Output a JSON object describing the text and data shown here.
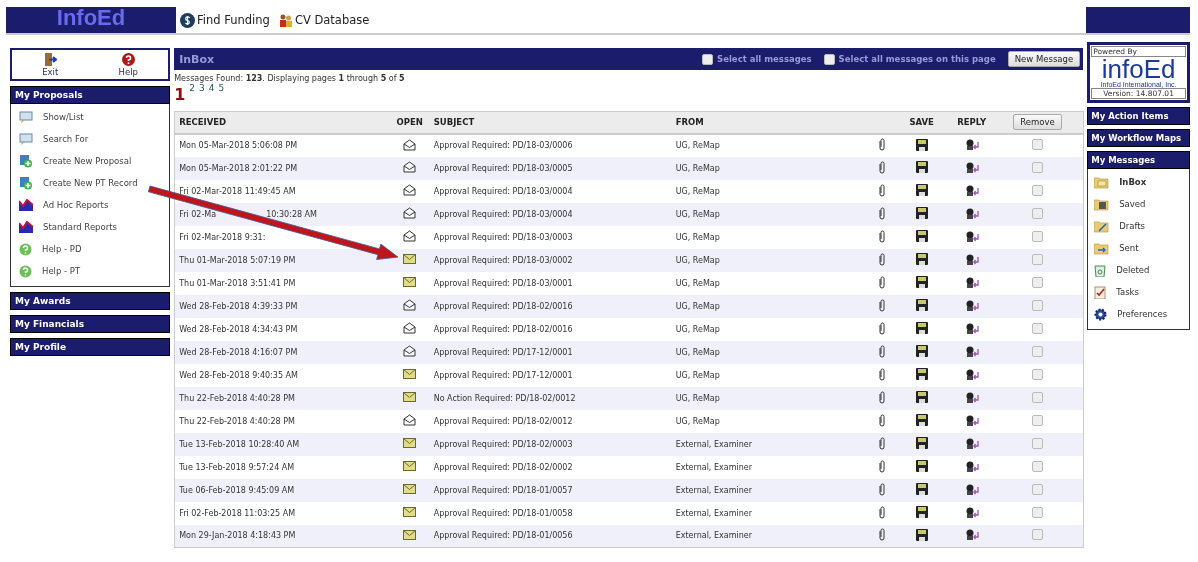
{
  "header": {
    "logo": "InfoEd",
    "links": [
      {
        "label": "Find Funding",
        "kind": "funding"
      },
      {
        "label": "CV Database",
        "kind": "cv"
      }
    ]
  },
  "toolbar": [
    {
      "label": "Exit",
      "kind": "exit"
    },
    {
      "label": "Help",
      "kind": "help"
    }
  ],
  "nav_sections": [
    {
      "title": "My Proposals",
      "items": [
        {
          "label": "Show/List",
          "kind": "list"
        },
        {
          "label": "Search For",
          "kind": "list"
        },
        {
          "label": "Create New Proposal",
          "kind": "create"
        },
        {
          "label": "Create New PT Record",
          "kind": "create"
        },
        {
          "label": "Ad Hoc Reports",
          "kind": "report"
        },
        {
          "label": "Standard Reports",
          "kind": "report"
        },
        {
          "label": "Help - PD",
          "kind": "help"
        },
        {
          "label": "Help - PT",
          "kind": "help"
        }
      ]
    },
    {
      "title": "My Awards"
    },
    {
      "title": "My Financials"
    },
    {
      "title": "My Profile"
    }
  ],
  "inbox": {
    "title": "InBox",
    "select_all": {
      "label": "Select all messages",
      "checked": false
    },
    "select_page": {
      "label": "Select all messages on this page",
      "checked": false
    },
    "new_message": "New Message",
    "summary": "Messages Found: **123**. Displaying pages **1** through **5** of **5**",
    "pages": [
      {
        "label": "1",
        "selected": true
      },
      {
        "label": "2",
        "selected": false
      },
      {
        "label": "3",
        "selected": false
      },
      {
        "label": "4",
        "selected": false
      },
      {
        "label": "5",
        "selected": false
      }
    ],
    "columns": {
      "received": "RECEIVED",
      "open": "OPEN",
      "subject": "SUBJECT",
      "from": "FROM",
      "save": "SAVE",
      "reply": "REPLY"
    },
    "remove": "Remove",
    "rows": [
      {
        "received": "Mon 05-Mar-2018 5:06:08 PM",
        "read": true,
        "subject": "Approval Required: PD/18-03/0006",
        "from": "UG, ReMap",
        "checked": false
      },
      {
        "received": "Mon 05-Mar-2018 2:01:22 PM",
        "read": true,
        "subject": "Approval Required: PD/18-03/0005",
        "from": "UG, ReMap",
        "checked": false
      },
      {
        "received": "Fri 02-Mar-2018 11:49:45 AM",
        "read": true,
        "subject": "Approval Required: PD/18-03/0004",
        "from": "UG, ReMap",
        "checked": false
      },
      {
        "received": [
          "Fri 02-Ma",
          "10:30:28 AM"
        ],
        "read": true,
        "subject": "Approval Required: PD/18-03/0004",
        "from": "UG, ReMap",
        "checked": false
      },
      {
        "received": [
          "Fri 02-Mar-2018 9:31:"
        ],
        "read": true,
        "subject": "Approval Required: PD/18-03/0003",
        "from": "UG, ReMap",
        "checked": false
      },
      {
        "received": "Thu 01-Mar-2018 5:07:19 PM",
        "read": false,
        "subject": "Approval Required: PD/18-03/0002",
        "from": "UG, ReMap",
        "checked": false
      },
      {
        "received": "Thu 01-Mar-2018 3:51:41 PM",
        "read": false,
        "subject": "Approval Required: PD/18-03/0001",
        "from": "UG, ReMap",
        "checked": false
      },
      {
        "received": "Wed 28-Feb-2018 4:39:33 PM",
        "read": true,
        "subject": "Approval Required: PD/18-02/0016",
        "from": "UG, ReMap",
        "checked": false
      },
      {
        "received": "Wed 28-Feb-2018 4:34:43 PM",
        "read": true,
        "subject": "Approval Required: PD/18-02/0016",
        "from": "UG, ReMap",
        "checked": false
      },
      {
        "received": "Wed 28-Feb-2018 4:16:07 PM",
        "read": true,
        "subject": "Approval Required: PD/17-12/0001",
        "from": "UG, ReMap",
        "checked": false
      },
      {
        "received": "Wed 28-Feb-2018 9:40:35 AM",
        "read": false,
        "subject": "Approval Required: PD/17-12/0001",
        "from": "UG, ReMap",
        "checked": false
      },
      {
        "received": "Thu 22-Feb-2018 4:40:28 PM",
        "read": false,
        "subject": "No Action Required: PD/18-02/0012",
        "from": "UG, ReMap",
        "checked": false
      },
      {
        "received": "Thu 22-Feb-2018 4:40:28 PM",
        "read": true,
        "subject": "Approval Required: PD/18-02/0012",
        "from": "UG, ReMap",
        "checked": false
      },
      {
        "received": "Tue 13-Feb-2018 10:28:40 AM",
        "read": false,
        "subject": "Approval Required: PD/18-02/0003",
        "from": "External, Examiner",
        "checked": false
      },
      {
        "received": "Tue 13-Feb-2018 9:57:24 AM",
        "read": false,
        "subject": "Approval Required: PD/18-02/0002",
        "from": "External, Examiner",
        "checked": false
      },
      {
        "received": "Tue 06-Feb-2018 9:45:09 AM",
        "read": false,
        "subject": "Approval Required: PD/18-01/0057",
        "from": "External, Examiner",
        "checked": false
      },
      {
        "received": "Fri 02-Feb-2018 11:03:25 AM",
        "read": false,
        "subject": "Approval Required: PD/18-01/0058",
        "from": "External, Examiner",
        "checked": false
      },
      {
        "received": "Mon 29-Jan-2018 4:18:43 PM",
        "read": false,
        "subject": "Approval Required: PD/18-01/0056",
        "from": "External, Examiner",
        "checked": false
      }
    ]
  },
  "powered_by": {
    "label": "Powered By",
    "logo": "infoEd",
    "company": "InfoEd International, Inc.",
    "version": "Version: 14.807.01"
  },
  "right_sections": [
    {
      "title": "My Action Items"
    },
    {
      "title": "My Workflow Maps"
    },
    {
      "title": "My Messages",
      "items": [
        {
          "label": "InBox",
          "kind": "inbox",
          "selected": true
        },
        {
          "label": "Saved",
          "kind": "saved",
          "selected": false
        },
        {
          "label": "Drafts",
          "kind": "drafts",
          "selected": false
        },
        {
          "label": "Sent",
          "kind": "sent",
          "selected": false
        },
        {
          "label": "Deleted",
          "kind": "deleted",
          "selected": false
        },
        {
          "label": "Tasks",
          "kind": "tasks",
          "selected": false
        },
        {
          "label": "Preferences",
          "kind": "prefs",
          "selected": false
        }
      ]
    }
  ]
}
